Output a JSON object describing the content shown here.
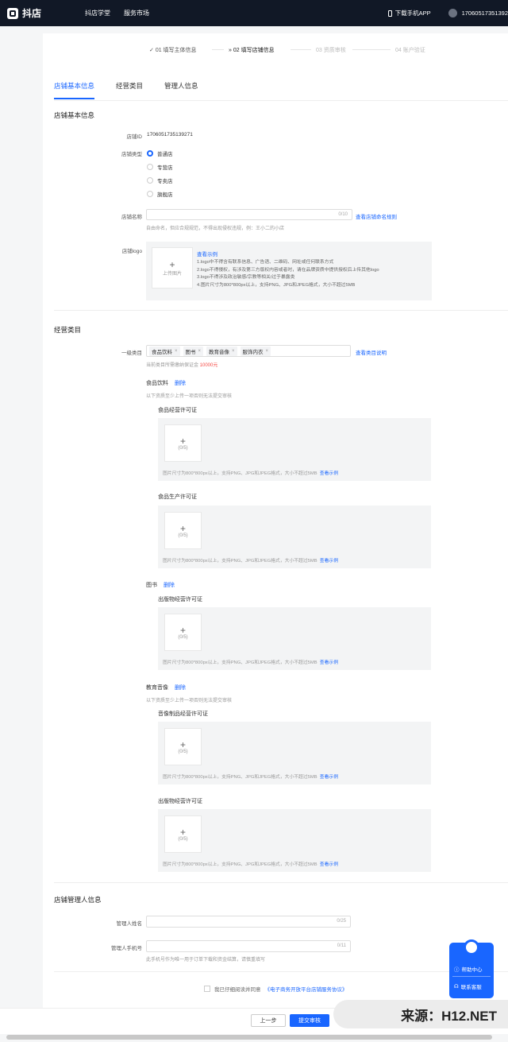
{
  "topbar": {
    "logo_text": "抖店",
    "nav": [
      "抖店学堂",
      "服务市场"
    ],
    "download_app": "下载手机APP",
    "user_id": "17060517351392"
  },
  "steps": [
    {
      "label": "01 填写主体信息",
      "icon": "check",
      "state": "done"
    },
    {
      "label": "02 填写店铺信息",
      "icon": "arrows",
      "state": "current"
    },
    {
      "label": "03 资质审核",
      "state": "todo"
    },
    {
      "label": "04 账户验证",
      "state": "todo"
    }
  ],
  "tabs": [
    "店铺基本信息",
    "经营类目",
    "管理人信息"
  ],
  "basic": {
    "section_title": "店铺基本信息",
    "shop_id_label": "店铺ID",
    "shop_id": "1706051735139271",
    "shop_type_label": "店铺类型",
    "shop_types": [
      "普通店",
      "专营店",
      "专卖店",
      "旗舰店"
    ],
    "shop_name_label": "店铺名称",
    "shop_name_counter": "0/10",
    "shop_name_rule_link": "查看店铺命名规则",
    "shop_name_hint": "自由命名，但应合规规范，不得出现侵权违规，例：王小二的小店",
    "logo_label": "店铺logo",
    "upload_label": "上传图片",
    "view_example": "查看示例",
    "logo_rules": [
      "1.logo中不得含有联系信息、广告语、二维码、网址或任何联系方式",
      "2.logo不得侵权，有涉及第三方版权内容或者时，请在品牌资质中提供授权后上传其他logo",
      "3.logo不得涉及政治敏感/宗教等相关/过于暴露类",
      "4.图片尺寸为800*800px以上，支持PNG、JPG和JPEG格式，大小不超过5MB"
    ]
  },
  "category": {
    "section_title": "经营类目",
    "primary_label": "一级类目",
    "tags": [
      "食品饮料",
      "图书",
      "教育音像",
      "服饰内衣"
    ],
    "explain_link": "查看类目说明",
    "deposit_hint": "当前类目所需缴纳保证金 ",
    "deposit_amount": "10000元",
    "delete_label": "删除",
    "groups": [
      {
        "name": "食品饮料",
        "hint": "以下资质至少上传一项否则无法提交审核",
        "licenses": [
          "食品经营许可证",
          "食品生产许可证"
        ]
      },
      {
        "name": "图书",
        "hint": "",
        "licenses": [
          "出版物经营许可证"
        ]
      },
      {
        "name": "教育音像",
        "hint": "以下资质至少上传一项否则无法提交审核",
        "licenses": [
          "音像制品经营许可证",
          "出版物经营许可证"
        ]
      }
    ],
    "upload_count": "(0/5)",
    "license_hint": "图片尺寸为800*800px以上，支持PNG、JPG和JPEG格式，大小不超过5MB",
    "license_example": "查看示例"
  },
  "manager": {
    "section_title": "店铺管理人信息",
    "name_label": "管理人姓名",
    "name_counter": "0/25",
    "phone_label": "管理人手机号",
    "phone_counter": "0/11",
    "phone_hint": "此手机号作为唯一用于订单下载和资金结算，请慎重填写"
  },
  "agreement": {
    "prefix": "我已仔细阅读并同意",
    "link": "《电子商务开放平台店铺服务协议》"
  },
  "footer": {
    "prev": "上一步",
    "submit": "提交审核"
  },
  "helper": {
    "help_center": "帮助中心",
    "contact": "联系客服"
  },
  "watermark": "来源：H12.NET"
}
